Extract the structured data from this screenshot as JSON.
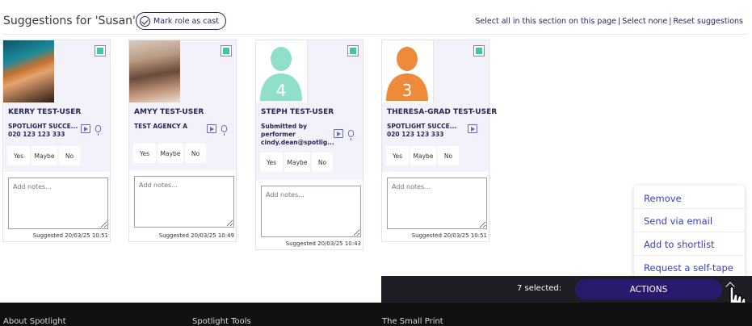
{
  "header": {
    "title": "Suggestions for 'Susan'",
    "mark_role_label": "Mark role as cast",
    "links": [
      "Select all in this section on this page",
      "Select none",
      "Reset suggestions"
    ]
  },
  "vote_labels": {
    "yes": "Yes",
    "maybe": "Maybe",
    "no": "No"
  },
  "notes_placeholder": "Add notes...",
  "cards": [
    {
      "name": "KERRY TEST-USER",
      "agency_lines": [
        "SPOTLIGHT SUCCE...",
        "020 123 123 333"
      ],
      "suggested": "Suggested 20/03/25 10:51",
      "has_mic": true
    },
    {
      "name": "AMYY TEST-USER",
      "agency_lines": [
        "TEST AGENCY A"
      ],
      "suggested": "Suggested 20/03/25 10:49",
      "has_mic": true
    },
    {
      "name": "STEPH TEST-USER",
      "agency_lines": [
        "Submitted by",
        "performer",
        "cindy.dean@spotlig..."
      ],
      "suggested": "Suggested 20/03/25 10:43",
      "avatar_number": "4",
      "avatar_color": "#8fdfcb",
      "has_mic": true
    },
    {
      "name": "THERESA-GRAD TEST-USER",
      "agency_lines": [
        "SPOTLIGHT SUCCE...",
        "020 123 123 333"
      ],
      "suggested": "Suggested 20/03/25 10:51",
      "avatar_number": "3",
      "avatar_color": "#ef8a3a",
      "has_mic": false
    }
  ],
  "menu": {
    "items": [
      "Remove",
      "Send via email",
      "Add to shortlist",
      "Request a self-tape"
    ]
  },
  "action_bar": {
    "selected_count": "7 selected:",
    "actions_label": "ACTIONS"
  },
  "footer": {
    "links": [
      "About Spotlight",
      "Spotlight Tools",
      "The Small Print"
    ]
  },
  "colors": {
    "accent": "#3b3fb8",
    "checkbox_fill": "#3cc7a6",
    "action_button": "#2a1a6e"
  }
}
